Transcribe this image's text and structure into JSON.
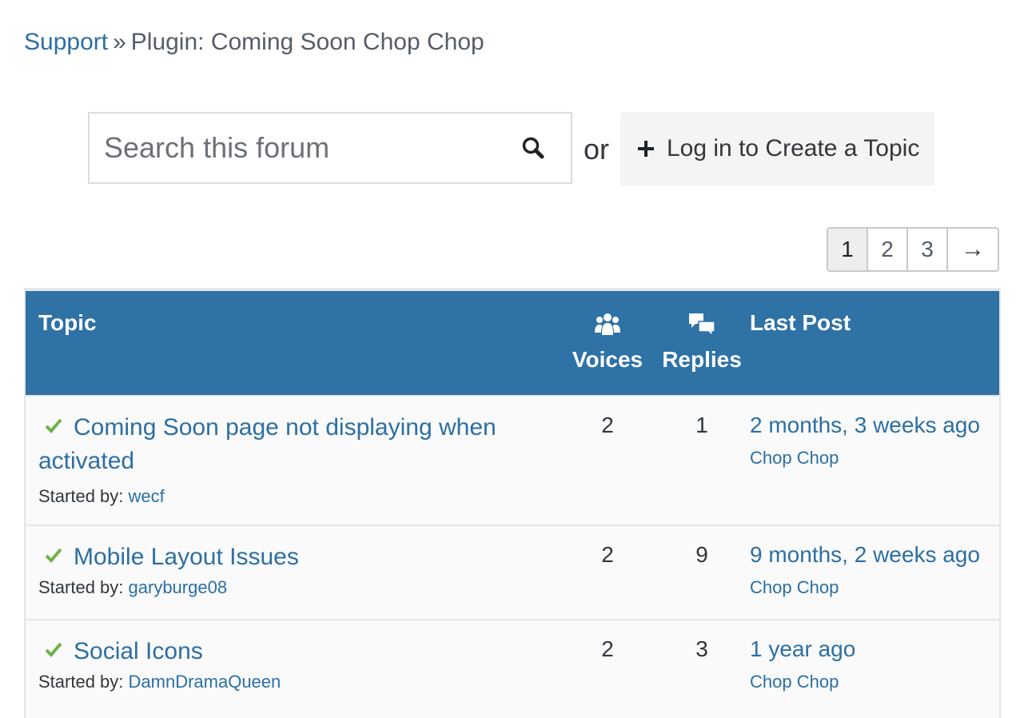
{
  "breadcrumb": {
    "root": "Support",
    "separator": "»",
    "current": "Plugin: Coming Soon Chop Chop"
  },
  "search": {
    "placeholder": "Search this forum",
    "value": "",
    "icon": "search-icon"
  },
  "or_label": "or",
  "create_topic": {
    "icon": "plus-icon",
    "label": "Log in to Create a Topic"
  },
  "pagination": {
    "pages": [
      "1",
      "2",
      "3"
    ],
    "current": "1",
    "next_label": "→"
  },
  "table": {
    "header": {
      "topic": "Topic",
      "voices": "Voices",
      "voices_icon": "users-icon",
      "replies": "Replies",
      "replies_icon": "chat-bubbles-icon",
      "last_post": "Last Post"
    },
    "started_by_label": "Started by:",
    "rows": [
      {
        "title": "Coming Soon page not displaying when activated",
        "resolved": true,
        "author": "wecf",
        "voices": "2",
        "replies": "1",
        "last_time": "2 months, 3 weeks ago",
        "last_author": "Chop Chop"
      },
      {
        "title": "Mobile Layout Issues",
        "resolved": true,
        "author": "garyburge08",
        "voices": "2",
        "replies": "9",
        "last_time": "9 months, 2 weeks ago",
        "last_author": "Chop Chop"
      },
      {
        "title": "Social Icons",
        "resolved": true,
        "author": "DamnDramaQueen",
        "voices": "2",
        "replies": "3",
        "last_time": "1 year ago",
        "last_author": "Chop Chop"
      }
    ]
  },
  "colors": {
    "header_bg": "#2e72a6",
    "link": "#2c6fa3",
    "resolved_check": "#6fb24b"
  }
}
